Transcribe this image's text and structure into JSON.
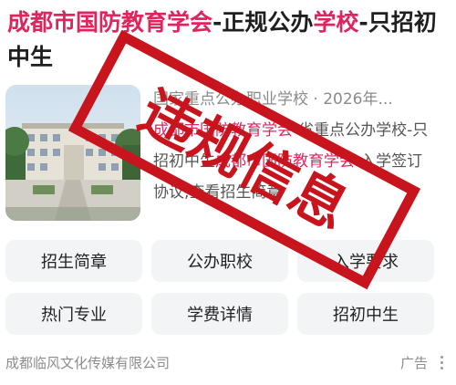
{
  "result": {
    "title_parts": [
      {
        "text": "成都市国防教育学会",
        "highlight": true
      },
      {
        "text": "-正规公办",
        "highlight": false
      },
      {
        "text": "学校",
        "highlight": true
      },
      {
        "text": "-只招初中生",
        "highlight": false
      }
    ],
    "snippet": {
      "meta": "国家重点公办职业学校 · 2026年...",
      "parts": [
        {
          "text": "成都市国防教育学会",
          "highlight": true
        },
        {
          "text": "-省重点公办学校-只招初中生",
          "highlight": false
        },
        {
          "text": "成都市国防教育学会",
          "highlight": true
        },
        {
          "text": "-入学签订协议,查看招生简章",
          "highlight": false
        }
      ]
    },
    "tags": [
      "招生简章",
      "公办职校",
      "入学要求",
      "热门专业",
      "学费详情",
      "招初中生"
    ],
    "advertiser": "成都临风文化传媒有限公司",
    "ad_label": "广告"
  },
  "overlay": {
    "stamp_text": "违规信息",
    "stamp_color": "#c8141c"
  },
  "colors": {
    "highlight": "#e0245e",
    "title": "#1f1f1f",
    "tag_bg": "#f3f4f6",
    "muted": "#8c8c8c"
  },
  "icons": {
    "more": "more-vertical-icon"
  }
}
